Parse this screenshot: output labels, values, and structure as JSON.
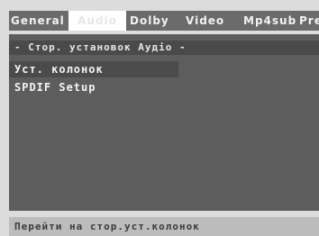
{
  "tabs": [
    {
      "label": "General",
      "active": false
    },
    {
      "label": "Audio",
      "active": true
    },
    {
      "label": "Dolby",
      "active": false
    },
    {
      "label": "Video",
      "active": false
    },
    {
      "label": "Mp4sub",
      "active": false
    },
    {
      "label": "Pref",
      "active": false
    }
  ],
  "panel": {
    "header": "- Стор. установок Аудіо -",
    "items": [
      {
        "label": "Уст. колонок",
        "selected": true
      },
      {
        "label": "SPDIF Setup",
        "selected": false
      }
    ]
  },
  "status": {
    "text": "Перейти на стор.уст.колонок"
  },
  "colors": {
    "panel_bg": "#5d5d5d",
    "tab_bar_bg": "#6b6b6b",
    "active_tab_bg": "#ffffff",
    "selected_item_bg": "#4b4b4b",
    "status_bar_bg": "#bcbcbc"
  }
}
